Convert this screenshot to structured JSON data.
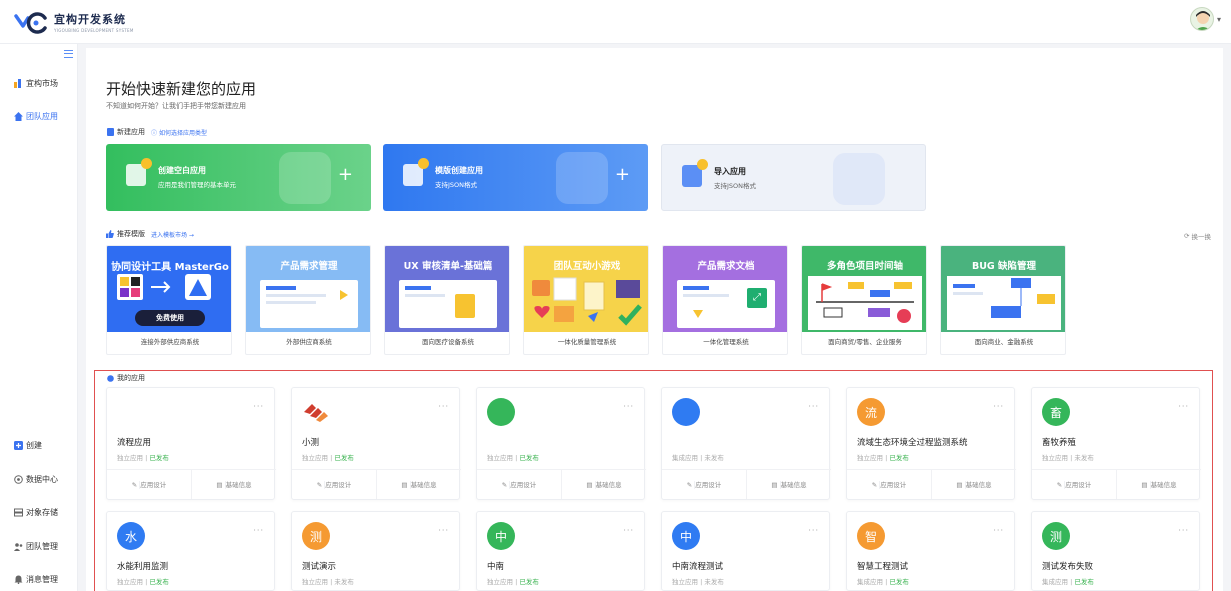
{
  "brand": {
    "title": "宜构开发系统",
    "subtitle": "YIGOUBING DEVELOPMENT SYSTEM"
  },
  "sidebar": {
    "top_items": [
      {
        "label": "宜构市场",
        "icon": "market-icon"
      },
      {
        "label": "团队应用",
        "icon": "home-icon",
        "active": true
      }
    ],
    "bottom_items": [
      {
        "label": "创建",
        "icon": "create-icon"
      },
      {
        "label": "数据中心",
        "icon": "data-center-icon"
      },
      {
        "label": "对象存储",
        "icon": "storage-icon"
      },
      {
        "label": "团队管理",
        "icon": "team-icon"
      },
      {
        "label": "消息管理",
        "icon": "message-icon"
      }
    ]
  },
  "header": {
    "title": "开始快速新建您的应用",
    "subtitle": "不知道如何开始？让我们手把手带您新建应用"
  },
  "new_app": {
    "label": "新建应用",
    "help_link": "如何选择应用类型",
    "cards": [
      {
        "title": "创建空白应用",
        "desc": "应用是我们管理的基本单元",
        "color": "#3ec36b"
      },
      {
        "title": "模版创建应用",
        "desc": "支持JSON格式",
        "color": "#3b82f0"
      },
      {
        "title": "导入应用",
        "desc": "支持JSON格式",
        "color": "#eef2f9"
      }
    ]
  },
  "templates": {
    "label": "推荐模版",
    "link": "进入模板市场 →",
    "refresh": "换一换",
    "items": [
      {
        "name": "协同设计工具 MasterGo",
        "desc": "连接外部供应商系统",
        "color": "#2f6df2",
        "cta": "免费使用"
      },
      {
        "name": "产品需求管理",
        "desc": "外部供应商系统",
        "color": "#7db4f3"
      },
      {
        "name": "UX 审核清单-基础篇",
        "desc": "面向医疗设备系统",
        "color": "#6a72d8"
      },
      {
        "name": "团队互动小游戏",
        "desc": "一体化质量管理系统",
        "color": "#f7cf3d"
      },
      {
        "name": "产品需求文档",
        "desc": "一体化管理系统",
        "color": "#a46fe0"
      },
      {
        "name": "多角色项目时间轴",
        "desc": "面向商贸/零售、企业服务",
        "color": "#3fb869"
      },
      {
        "name": "BUG 缺陷管理",
        "desc": "面向商业、金融系统",
        "color": "#47b27a"
      }
    ]
  },
  "my_apps": {
    "label": "我的应用",
    "action_design": "应用设计",
    "action_info": "基础信息",
    "more": "···",
    "sep": " | ",
    "items": [
      {
        "name": "流程应用",
        "type": "独立应用",
        "status": "已发布",
        "published": true,
        "icon": "",
        "color": ""
      },
      {
        "name": "小测",
        "type": "独立应用",
        "status": "已发布",
        "published": true,
        "icon": "",
        "color": "#d03d2e"
      },
      {
        "name": "",
        "type": "独立应用",
        "status": "已发布",
        "published": true,
        "icon": "",
        "color": "#35b65a"
      },
      {
        "name": "",
        "type": "集成应用",
        "status": "未发布",
        "published": false,
        "icon": "",
        "color": "#2f7bf2"
      },
      {
        "name": "流域生态环境全过程监测系统",
        "type": "独立应用",
        "status": "已发布",
        "published": true,
        "icon": "流",
        "color": "#f59a32"
      },
      {
        "name": "畜牧养殖",
        "type": "独立应用",
        "status": "未发布",
        "published": false,
        "icon": "畜",
        "color": "#35b65a"
      },
      {
        "name": "水能利用监测",
        "type": "独立应用",
        "status": "已发布",
        "published": true,
        "icon": "水",
        "color": "#2f7bf2"
      },
      {
        "name": "测试演示",
        "type": "独立应用",
        "status": "未发布",
        "published": false,
        "icon": "测",
        "color": "#f59a32"
      },
      {
        "name": "中南",
        "type": "独立应用",
        "status": "已发布",
        "published": true,
        "icon": "中",
        "color": "#35b65a"
      },
      {
        "name": "中南流程测试",
        "type": "独立应用",
        "status": "未发布",
        "published": false,
        "icon": "中",
        "color": "#2f7bf2"
      },
      {
        "name": "智慧工程测试",
        "type": "集成应用",
        "status": "已发布",
        "published": true,
        "icon": "智",
        "color": "#f59a32"
      },
      {
        "name": "测试发布失败",
        "type": "集成应用",
        "status": "已发布",
        "published": true,
        "icon": "测",
        "color": "#35b65a"
      }
    ]
  }
}
